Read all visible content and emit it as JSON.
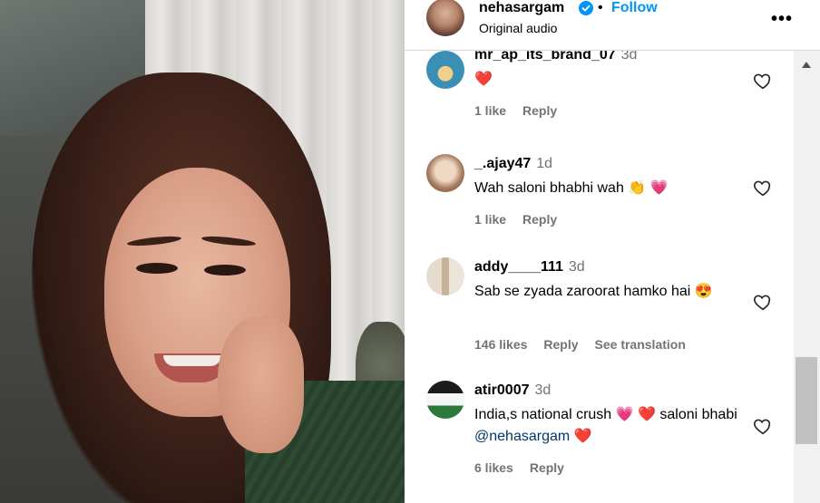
{
  "header": {
    "username": "nehasargam",
    "separator": "•",
    "follow_label": "Follow",
    "subtitle": "Original audio",
    "more_label": "•••"
  },
  "comments": [
    {
      "username": "mr_ap_its_brand_07",
      "time": "3d",
      "text": "❤️",
      "likes": "1 like",
      "reply": "Reply",
      "avatar_color": "#3a8fb5"
    },
    {
      "username": "_.ajay47",
      "time": "1d",
      "text": "Wah saloni bhabhi wah 👏 💗",
      "likes": "1 like",
      "reply": "Reply",
      "avatar_color": "#c9a58a"
    },
    {
      "username": "addy____111",
      "time": "3d",
      "text": "Sab se zyada zaroorat hamko hai 😍",
      "likes": "146 likes",
      "reply": "Reply",
      "translate": "See translation",
      "avatar_color": "#d8cbb8"
    },
    {
      "username": "atir0007",
      "time": "3d",
      "text_before": "India,s national crush 💗 ❤️  saloni bhabi ",
      "mention": "@nehasargam",
      "text_after": " ❤️",
      "likes": "6 likes",
      "reply": "Reply",
      "avatar_color": "#2c7a3a"
    }
  ],
  "colors": {
    "link_blue": "#0095f6",
    "muted": "#737373",
    "mention": "#00376b"
  }
}
